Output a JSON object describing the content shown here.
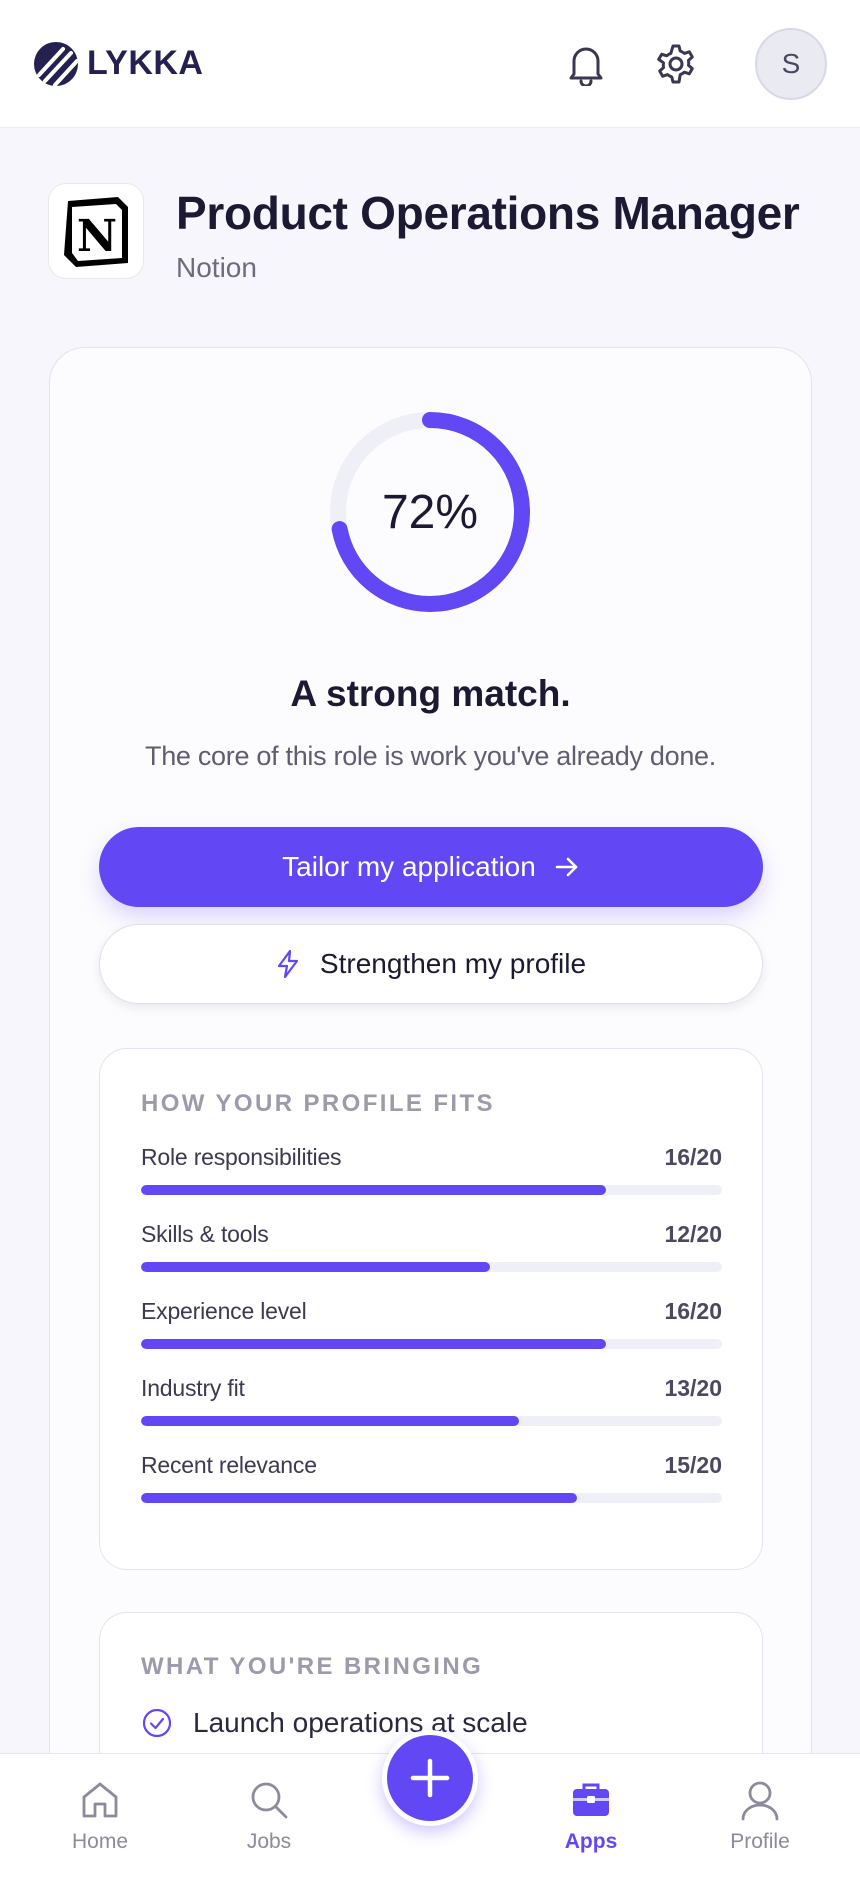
{
  "header": {
    "brand": "LYKKA",
    "avatar_initial": "S",
    "icons": [
      "bell-icon",
      "gear-icon"
    ]
  },
  "job": {
    "title": "Product Operations Manager",
    "company": "Notion",
    "logo_letter": "N"
  },
  "match": {
    "percent_label": "72%",
    "percent": 72,
    "title": "A strong match.",
    "subtitle": "The core of this role is work you've already done."
  },
  "actions": {
    "primary_label": "Tailor my application",
    "secondary_label": "Strengthen my profile"
  },
  "fit": {
    "heading": "HOW YOUR PROFILE FITS",
    "rows": [
      {
        "label": "Role responsibilities",
        "score": "16/20",
        "value": 0.8
      },
      {
        "label": "Skills & tools",
        "score": "12/20",
        "value": 0.6
      },
      {
        "label": "Experience level",
        "score": "16/20",
        "value": 0.8
      },
      {
        "label": "Industry fit",
        "score": "13/20",
        "value": 0.65
      },
      {
        "label": "Recent relevance",
        "score": "15/20",
        "value": 0.75
      }
    ]
  },
  "bringing": {
    "heading": "WHAT YOU'RE BRINGING",
    "items": [
      "Launch operations at scale"
    ]
  },
  "nav": {
    "items": [
      {
        "label": "Home",
        "icon": "home-icon"
      },
      {
        "label": "Jobs",
        "icon": "search-icon"
      },
      {
        "label": "Apps",
        "icon": "briefcase-icon",
        "active": true
      },
      {
        "label": "Profile",
        "icon": "user-icon"
      }
    ],
    "fab_icon": "plus-icon"
  },
  "colors": {
    "accent": "#6247f5",
    "brand": "#24204f",
    "track": "#efeff7"
  }
}
